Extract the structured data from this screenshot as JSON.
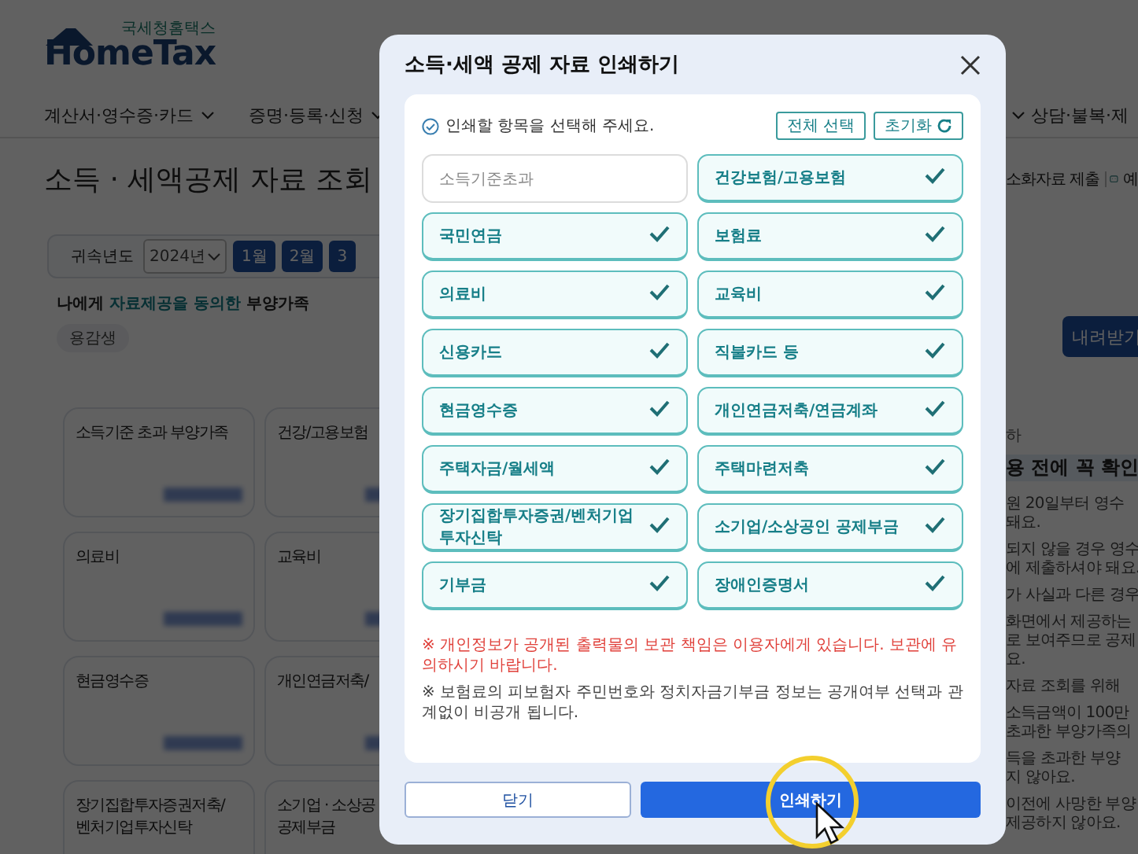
{
  "header": {
    "logo_caption": "국세청홈택스",
    "logo": "HomeTax"
  },
  "nav": [
    {
      "label": "계산서·영수증·카드"
    },
    {
      "label": "증명·등록·신청"
    }
  ],
  "nav_right": {
    "label": "상담·불복·제"
  },
  "page_title": "소득 · 세액공제 자료 조회",
  "page_actions": {
    "submit": "소화자료 제출",
    "more": "예"
  },
  "filter": {
    "label": "귀속년도",
    "year": "2024년",
    "months": [
      "1월",
      "2월",
      "3"
    ]
  },
  "consent": {
    "prefix": "나에게 ",
    "highlight": "자료제공을 동의한",
    "suffix": " 부양가족",
    "chip": "용감생"
  },
  "download_button": "내려받기",
  "cards": [
    {
      "title": [
        "소득기준 초과 부양가족"
      ]
    },
    {
      "title": [
        "건강/고용보험"
      ]
    },
    {
      "title": [
        "의료비"
      ]
    },
    {
      "title": [
        "교육비"
      ]
    },
    {
      "title": [
        "현금영수증"
      ]
    },
    {
      "title": [
        "개인연금저축/"
      ]
    },
    {
      "title": [
        "장기집합투자증권저축/",
        "벤처기업투자신탁"
      ]
    },
    {
      "title": [
        "소기업 · 소상공",
        "공제부금"
      ]
    }
  ],
  "notice_panel": {
    "kicker": "하",
    "heading": "용 전에 꼭 확인",
    "paragraphs": [
      [
        "원 20일부터 영수",
        "돼요."
      ],
      [
        "되지 않을 경우 영수",
        "에 제출하셔야 돼요."
      ],
      [
        "가 사실과 다른 경우"
      ],
      [
        "화면에서 제공하는",
        "로 보여주므로 공제",
        "요."
      ],
      [
        "자료 조회를 위해"
      ],
      [
        "소득금액이 100만",
        "초과한 부양가족의"
      ],
      [
        "득을 초과한 부양",
        "지 않아요."
      ],
      [
        "이전에 사망한 부양",
        "제공하지 않아요."
      ]
    ]
  },
  "modal": {
    "title": "소득·세액 공제 자료 인쇄하기",
    "instruction": "인쇄할 항목을 선택해 주세요.",
    "select_all": "전체 선택",
    "reset": "초기화",
    "items": [
      {
        "label": "소득기준초과",
        "selected": false
      },
      {
        "label": "건강보험/고용보험",
        "selected": true
      },
      {
        "label": "국민연금",
        "selected": true
      },
      {
        "label": "보험료",
        "selected": true
      },
      {
        "label": "의료비",
        "selected": true
      },
      {
        "label": "교육비",
        "selected": true
      },
      {
        "label": "신용카드",
        "selected": true
      },
      {
        "label": "직불카드 등",
        "selected": true
      },
      {
        "label": "현금영수증",
        "selected": true
      },
      {
        "label": "개인연금저축/연금계좌",
        "selected": true
      },
      {
        "label": "주택자금/월세액",
        "selected": true
      },
      {
        "label": "주택마련저축",
        "selected": true
      },
      {
        "label": "장기집합투자증권/벤처기업투자신탁",
        "selected": true
      },
      {
        "label": "소기업/소상공인 공제부금",
        "selected": true
      },
      {
        "label": "기부금",
        "selected": true
      },
      {
        "label": "장애인증명서",
        "selected": true
      }
    ],
    "notices": [
      {
        "kind": "warning",
        "text": "※ 개인정보가 공개된 출력물의 보관 책임은 이용자에게 있습니다. 보관에 유의하시기 바랍니다."
      },
      {
        "kind": "info",
        "text": "※ 보험료의 피보험자 주민번호와 정치자금기부금 정보는 공개여부 선택과 관계없이 비공개 됩니다."
      }
    ],
    "close_button": "닫기",
    "print_button": "인쇄하기"
  }
}
